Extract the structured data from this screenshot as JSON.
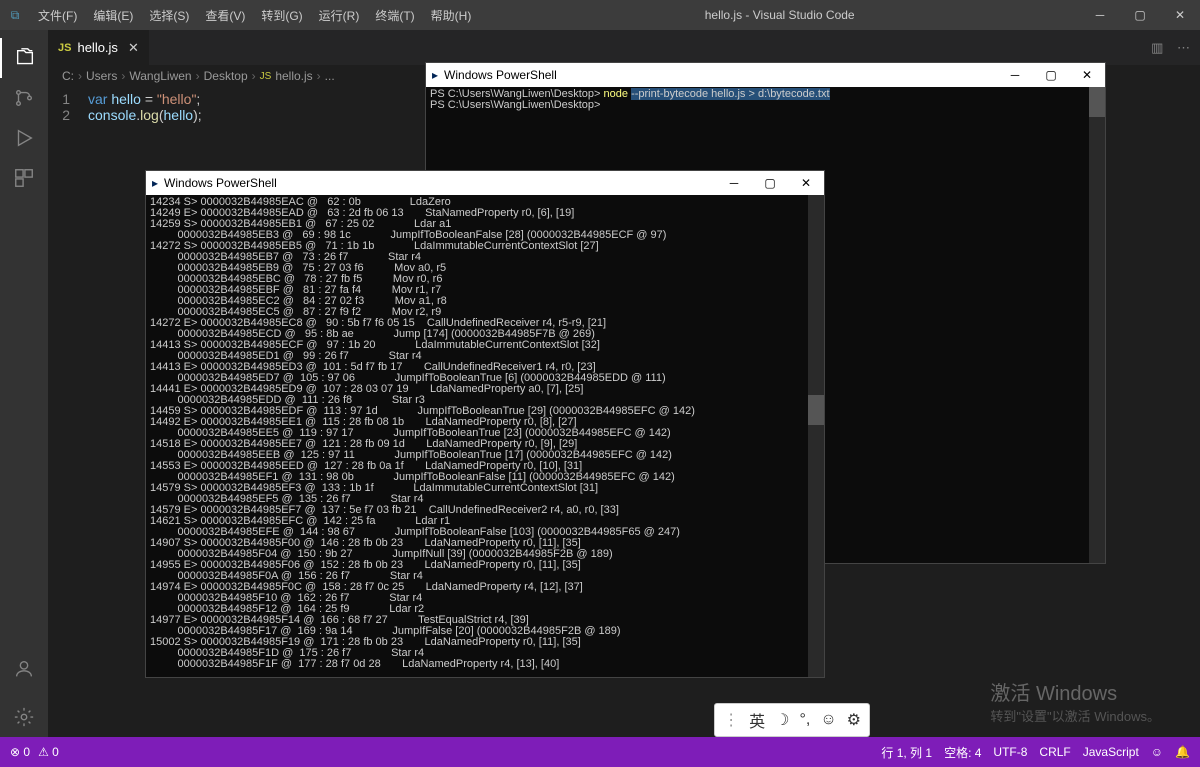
{
  "title": "hello.js - Visual Studio Code",
  "menu": [
    "文件(F)",
    "编辑(E)",
    "选择(S)",
    "查看(V)",
    "转到(G)",
    "运行(R)",
    "终端(T)",
    "帮助(H)"
  ],
  "tab": {
    "icon": "JS",
    "name": "hello.js"
  },
  "breadcrumb": [
    "C:",
    "Users",
    "WangLiwen",
    "Desktop",
    "hello.js",
    "..."
  ],
  "code": {
    "l1": {
      "kw": "var",
      "vn": " hello ",
      "eq": "=",
      "str": " \"hello\"",
      "end": ";"
    },
    "l2": {
      "obj": "console",
      "dot": ".",
      "fn": "log",
      "op": "(",
      "arg": "hello",
      "cp": ")",
      "end": ";"
    }
  },
  "ps1": {
    "title": "Windows PowerShell",
    "prompt": "PS C:\\Users\\WangLiwen\\Desktop>",
    "cmd_node": "node",
    "cmd_args": "--print-bytecode",
    "cmd_tail": " hello.js > d:\\bytecode.txt",
    "prompt2": "PS C:\\Users\\WangLiwen\\Desktop>"
  },
  "ps2": {
    "title": "Windows PowerShell",
    "lines": [
      "14234 S> 0000032B44985EAC @   62 : 0b                LdaZero",
      "14249 E> 0000032B44985EAD @   63 : 2d fb 06 13       StaNamedProperty r0, [6], [19]",
      "14259 S> 0000032B44985EB1 @   67 : 25 02             Ldar a1",
      "         0000032B44985EB3 @   69 : 98 1c             JumpIfToBooleanFalse [28] (0000032B44985ECF @ 97)",
      "14272 S> 0000032B44985EB5 @   71 : 1b 1b             LdaImmutableCurrentContextSlot [27]",
      "         0000032B44985EB7 @   73 : 26 f7             Star r4",
      "         0000032B44985EB9 @   75 : 27 03 f6          Mov a0, r5",
      "         0000032B44985EBC @   78 : 27 fb f5          Mov r0, r6",
      "         0000032B44985EBF @   81 : 27 fa f4          Mov r1, r7",
      "         0000032B44985EC2 @   84 : 27 02 f3          Mov a1, r8",
      "         0000032B44985EC5 @   87 : 27 f9 f2          Mov r2, r9",
      "14272 E> 0000032B44985EC8 @   90 : 5b f7 f6 05 15    CallUndefinedReceiver r4, r5-r9, [21]",
      "         0000032B44985ECD @   95 : 8b ae             Jump [174] (0000032B44985F7B @ 269)",
      "14413 S> 0000032B44985ECF @   97 : 1b 20             LdaImmutableCurrentContextSlot [32]",
      "         0000032B44985ED1 @   99 : 26 f7             Star r4",
      "14413 E> 0000032B44985ED3 @  101 : 5d f7 fb 17       CallUndefinedReceiver1 r4, r0, [23]",
      "         0000032B44985ED7 @  105 : 97 06             JumpIfToBooleanTrue [6] (0000032B44985EDD @ 111)",
      "14441 E> 0000032B44985ED9 @  107 : 28 03 07 19       LdaNamedProperty a0, [7], [25]",
      "         0000032B44985EDD @  111 : 26 f8             Star r3",
      "14459 S> 0000032B44985EDF @  113 : 97 1d             JumpIfToBooleanTrue [29] (0000032B44985EFC @ 142)",
      "14492 E> 0000032B44985EE1 @  115 : 28 fb 08 1b       LdaNamedProperty r0, [8], [27]",
      "         0000032B44985EE5 @  119 : 97 17             JumpIfToBooleanTrue [23] (0000032B44985EFC @ 142)",
      "14518 E> 0000032B44985EE7 @  121 : 28 fb 09 1d       LdaNamedProperty r0, [9], [29]",
      "         0000032B44985EEB @  125 : 97 11             JumpIfToBooleanTrue [17] (0000032B44985EFC @ 142)",
      "14553 E> 0000032B44985EED @  127 : 28 fb 0a 1f       LdaNamedProperty r0, [10], [31]",
      "         0000032B44985EF1 @  131 : 98 0b             JumpIfToBooleanFalse [11] (0000032B44985EFC @ 142)",
      "14579 S> 0000032B44985EF3 @  133 : 1b 1f             LdaImmutableCurrentContextSlot [31]",
      "         0000032B44985EF5 @  135 : 26 f7             Star r4",
      "14579 E> 0000032B44985EF7 @  137 : 5e f7 03 fb 21    CallUndefinedReceiver2 r4, a0, r0, [33]",
      "14621 S> 0000032B44985EFC @  142 : 25 fa             Ldar r1",
      "         0000032B44985EFE @  144 : 98 67             JumpIfToBooleanFalse [103] (0000032B44985F65 @ 247)",
      "14907 S> 0000032B44985F00 @  146 : 28 fb 0b 23       LdaNamedProperty r0, [11], [35]",
      "         0000032B44985F04 @  150 : 9b 27             JumpIfNull [39] (0000032B44985F2B @ 189)",
      "14955 E> 0000032B44985F06 @  152 : 28 fb 0b 23       LdaNamedProperty r0, [11], [35]",
      "         0000032B44985F0A @  156 : 26 f7             Star r4",
      "14974 E> 0000032B44985F0C @  158 : 28 f7 0c 25       LdaNamedProperty r4, [12], [37]",
      "         0000032B44985F10 @  162 : 26 f7             Star r4",
      "         0000032B44985F12 @  164 : 25 f9             Ldar r2",
      "14977 E> 0000032B44985F14 @  166 : 68 f7 27          TestEqualStrict r4, [39]",
      "         0000032B44985F17 @  169 : 9a 14             JumpIfFalse [20] (0000032B44985F2B @ 189)",
      "15002 S> 0000032B44985F19 @  171 : 28 fb 0b 23       LdaNamedProperty r0, [11], [35]",
      "         0000032B44985F1D @  175 : 26 f7             Star r4",
      "         0000032B44985F1F @  177 : 28 f7 0d 28       LdaNamedProperty r4, [13], [40]"
    ]
  },
  "watermark": {
    "big": "激活 Windows",
    "small": "转到\"设置\"以激活 Windows。"
  },
  "status": {
    "err": "0",
    "warn": "0",
    "pos": "行 1, 列 1",
    "spaces": "空格: 4",
    "enc": "UTF-8",
    "eol": "CRLF",
    "lang": "JavaScript"
  },
  "ime": "英"
}
